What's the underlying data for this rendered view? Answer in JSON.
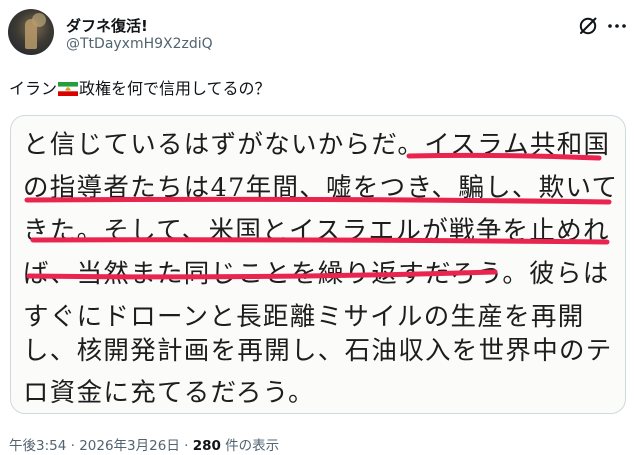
{
  "author": {
    "display_name": "ダフネ復活!",
    "handle": "@TtDayxmH9X2zdiQ"
  },
  "tweet": {
    "text_before_flag": "イラン",
    "flag_icon": "iran-lion-and-sun-flag",
    "text_after_flag": "政権を何で信用してるの？"
  },
  "quoted_image": {
    "lines": [
      "と信じているはずがないからだ。イスラム共和国",
      "の指導者たちは47年間、嘘をつき、騙し、欺いて",
      "きた。そして、米国とイスラエルが戦争を止めれ",
      "ば、当然また同じことを繰り返すだろう。彼らは",
      "すぐにドローンと長距離ミサイルの生産を再開",
      "し、核開発計画を再開し、石油収入を世界中のテ",
      "ロ資金に充てるだろう。"
    ],
    "highlight_color": "#e8244f"
  },
  "meta": {
    "time": "午後3:54",
    "separator": " · ",
    "date": "2026年3月26日",
    "views_count": "280",
    "views_label": " 件の表示"
  },
  "colors": {
    "text": "#0f1419",
    "secondary": "#536471",
    "border": "#cfd9de"
  }
}
